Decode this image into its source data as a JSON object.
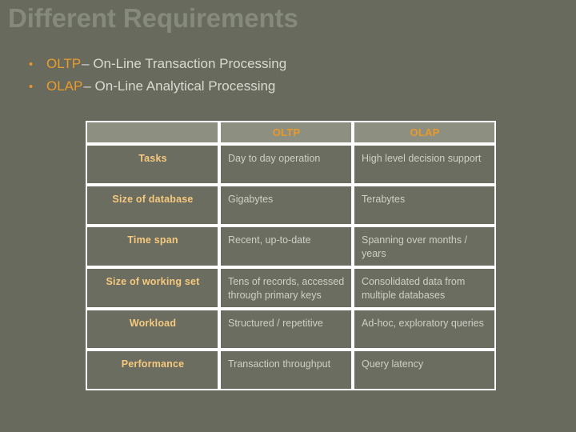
{
  "slide": {
    "title": "Different Requirements",
    "bullet_glyph": "•",
    "bullets": [
      {
        "key": "OLTP",
        "rest": " – On-Line Transaction Processing"
      },
      {
        "key": "OLAP",
        "rest": " – On-Line Analytical Processing"
      }
    ]
  },
  "table": {
    "columns": [
      "",
      "OLTP",
      "OLAP"
    ],
    "rows": [
      {
        "label": "Tasks",
        "oltp": "Day to day operation",
        "olap": "High level decision support"
      },
      {
        "label": "Size of database",
        "oltp": "Gigabytes",
        "olap": "Terabytes"
      },
      {
        "label": "Time span",
        "oltp": "Recent, up-to-date",
        "olap": "Spanning over months / years"
      },
      {
        "label": "Size of working set",
        "oltp": "Tens of records, accessed through primary keys",
        "olap": "Consolidated data from multiple databases"
      },
      {
        "label": "Workload",
        "oltp": "Structured / repetitive",
        "olap": "Ad-hoc, exploratory queries"
      },
      {
        "label": "Performance",
        "oltp": "Transaction throughput",
        "olap": "Query latency"
      }
    ]
  },
  "colors": {
    "background": "#676a5c",
    "title": "#868a7c",
    "accent_orange": "#ea9a2a",
    "row_label_gold": "#f6c97e",
    "body_text": "#ced0c7",
    "header_cell_bg": "#8d8f81",
    "body_cell_bg": "#6a6d5f",
    "grid_line": "#ffffff"
  }
}
